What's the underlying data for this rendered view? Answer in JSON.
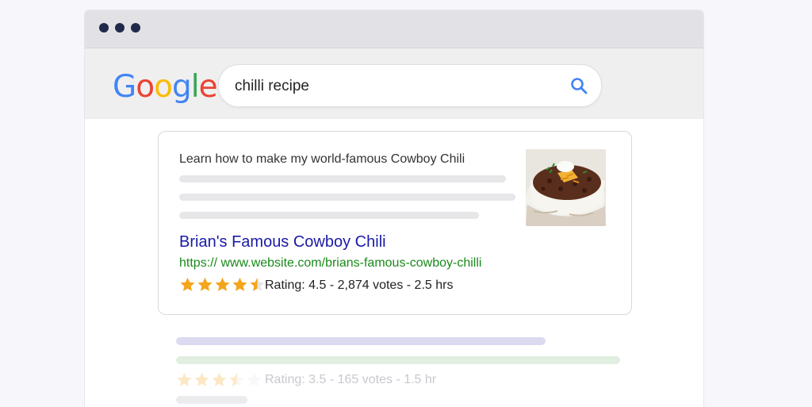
{
  "window": {
    "dots": [
      "dot",
      "dot",
      "dot"
    ]
  },
  "search": {
    "logo_letters": [
      {
        "ch": "G",
        "color": "#4285F4"
      },
      {
        "ch": "o",
        "color": "#EA4335"
      },
      {
        "ch": "o",
        "color": "#FBBC05"
      },
      {
        "ch": "g",
        "color": "#4285F4"
      },
      {
        "ch": "l",
        "color": "#34A853"
      },
      {
        "ch": "e",
        "color": "#EA4335"
      }
    ],
    "query": "chilli recipe",
    "icon": "search-icon"
  },
  "result": {
    "snippet": "Learn how to make my world-famous Cowboy Chili",
    "title": "Brian's Famous Cowboy Chili",
    "url": "https:// www.website.com/brians-famous-cowboy-chilli",
    "rating_text": "Rating: 4.5 - 2,874 votes - 2.5 hrs",
    "rating_value": 4.5,
    "rating_max": 5,
    "thumbnail": "bowl-of-chili-image"
  },
  "faded_result": {
    "rating_text": "Rating: 3.5 - 165 votes - 1.5 hr",
    "rating_value": 3.5,
    "rating_max": 5
  },
  "colors": {
    "star": "#F4A51C",
    "title_link": "#1a1aa6",
    "url": "#1a8a1a",
    "faded_title_bar": "#dcdaf0",
    "faded_url_bar": "#e1eee1"
  }
}
